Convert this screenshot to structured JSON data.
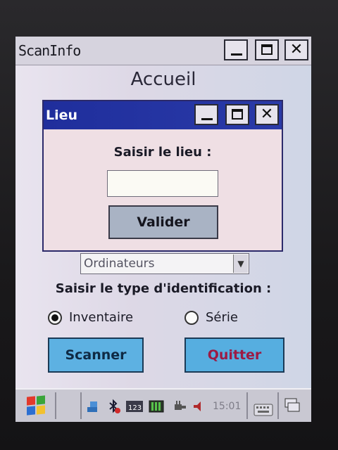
{
  "window": {
    "title": "ScanInfo",
    "close_glyph": "✕"
  },
  "page": {
    "title": "Accueil"
  },
  "dialog": {
    "title": "Lieu",
    "close_glyph": "✕",
    "prompt": "Saisir le lieu :",
    "input_value": "",
    "submit_label": "Valider"
  },
  "category_select": {
    "selected": "Ordinateurs",
    "arrow_glyph": "▼"
  },
  "identification": {
    "label": "Saisir le type d'identification :",
    "options": [
      {
        "label": "Inventaire",
        "selected": true
      },
      {
        "label": "Série",
        "selected": false
      }
    ]
  },
  "actions": {
    "scan_label": "Scanner",
    "quit_label": "Quitter"
  },
  "taskbar": {
    "clock": "15:01",
    "tray_icons": [
      "network-icon",
      "bluetooth-icon",
      "keypad-123-icon",
      "battery-icon",
      "power-plug-icon",
      "speaker-icon"
    ],
    "colors": {
      "start_red": "#e2392b",
      "start_green": "#3aa53a",
      "start_blue": "#2c6fd1",
      "start_yellow": "#f2c12e"
    }
  },
  "colors": {
    "dialog_titlebar": "#1f2e9c",
    "button_blue": "#5db1e2",
    "quit_text": "#9c1a44"
  }
}
